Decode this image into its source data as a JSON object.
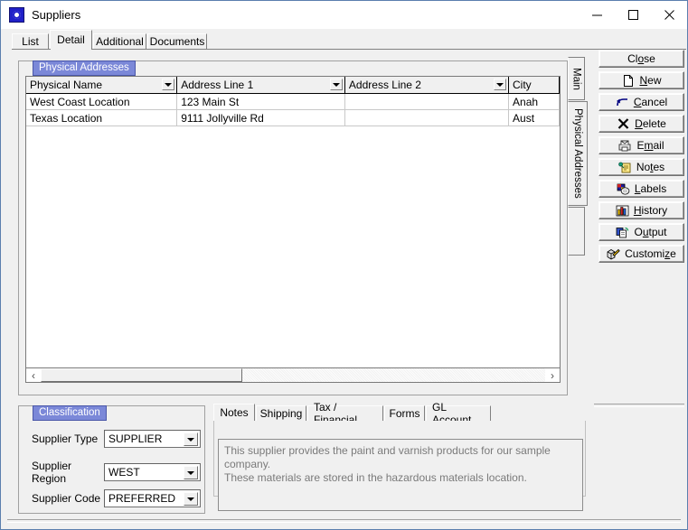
{
  "window": {
    "title": "Suppliers",
    "icon": "app-suppliers-icon",
    "controls": {
      "minimize": "minimize-icon",
      "maximize": "maximize-icon",
      "close": "close-icon"
    }
  },
  "colors": {
    "group_label_bg": "#7b88d8",
    "group_label_text": "#ffffff",
    "window_border": "#5b7fae",
    "face": "#f0f0f0",
    "notes_text": "#7a7a7a"
  },
  "tabs": [
    {
      "label": "List",
      "active": false
    },
    {
      "label": "Detail",
      "active": true
    },
    {
      "label": "Additional",
      "active": false
    },
    {
      "label": "Documents",
      "active": false
    }
  ],
  "addresses_group": {
    "label": "Physical Addresses",
    "grid": {
      "columns": [
        {
          "header": "Physical Name",
          "filter": true
        },
        {
          "header": "Address Line 1",
          "filter": true
        },
        {
          "header": "Address Line 2",
          "filter": true
        },
        {
          "header": "City",
          "filter": false
        }
      ],
      "rows": [
        [
          "West Coast Location",
          "123 Main St",
          "",
          "Anah"
        ],
        [
          "Texas Location",
          "9111 Jollyville Rd",
          "",
          "Aust"
        ]
      ]
    },
    "hscroll": {
      "left_arrow": "‹",
      "right_arrow": "›",
      "thumb_percent": 40
    }
  },
  "vertical_tabs": [
    {
      "label": "Main",
      "active": false
    },
    {
      "label": "Physical Addresses",
      "active": true
    }
  ],
  "action_buttons": [
    {
      "label": "Close",
      "accel": "o",
      "icon": "none"
    },
    {
      "label": "New",
      "accel": "N",
      "icon": "page-icon"
    },
    {
      "label": "Cancel",
      "accel": "C",
      "icon": "undo-arrow-icon"
    },
    {
      "label": "Delete",
      "accel": "D",
      "icon": "x-mark-icon"
    },
    {
      "label": "Email",
      "accel": "m",
      "icon": "envelope-printer-icon"
    },
    {
      "label": "Notes",
      "accel": "t",
      "icon": "notepad-pin-icon"
    },
    {
      "label": "Labels",
      "accel": "L",
      "icon": "labels-icon"
    },
    {
      "label": "History",
      "accel": "H",
      "icon": "bar-chart-icon"
    },
    {
      "label": "Output",
      "accel": "u",
      "icon": "copy-refresh-icon"
    },
    {
      "label": "Customize",
      "accel": "z",
      "icon": "pencil-box-icon"
    }
  ],
  "classification": {
    "label": "Classification",
    "fields": [
      {
        "label": "Supplier Type",
        "value": "SUPPLIER"
      },
      {
        "label": "Supplier Region",
        "value": "WEST"
      },
      {
        "label": "Supplier Code",
        "value": "PREFERRED"
      }
    ]
  },
  "notes_panel": {
    "tabs": [
      {
        "label": "Notes",
        "active": true
      },
      {
        "label": "Shipping",
        "active": false
      },
      {
        "label": "Tax / Financial",
        "active": false
      },
      {
        "label": "Forms",
        "active": false
      },
      {
        "label": "GL Account",
        "active": false
      }
    ],
    "text_line1": "This supplier provides the paint and varnish products for our sample company.",
    "text_line2": "These materials are stored in the hazardous materials location."
  }
}
